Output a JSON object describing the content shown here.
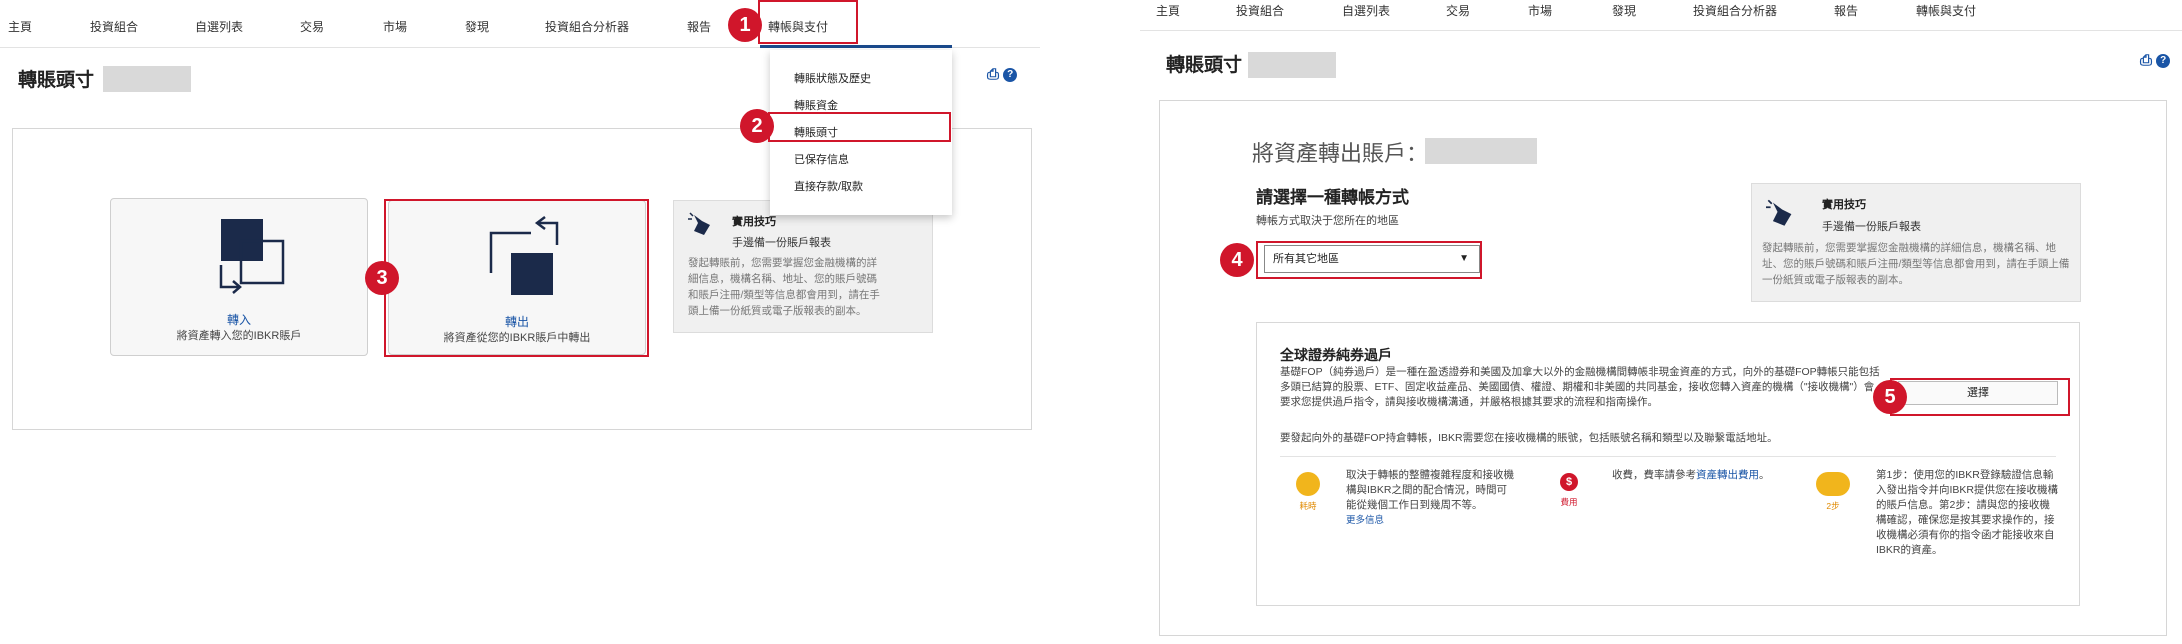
{
  "nav": {
    "items": [
      "主頁",
      "投資組合",
      "自選列表",
      "交易",
      "市場",
      "發現",
      "投資組合分析器",
      "報告",
      "轉帳與支付"
    ],
    "active": "轉帳與支付"
  },
  "left": {
    "page_title": "轉賬頭寸",
    "dropdown_items": [
      "轉賬狀態及歷史",
      "轉賬資金",
      "轉賬頭寸",
      "已保存信息",
      "直接存款/取款"
    ],
    "transfer_in": {
      "title": "轉入",
      "subtitle": "將資產轉入您的IBKR賬戶"
    },
    "transfer_out": {
      "title": "轉出",
      "subtitle": "將資產從您的IBKR賬戶中轉出"
    },
    "tip": {
      "title": "實用技巧",
      "subtitle": "手邊備一份賬戶報表",
      "body": "發起轉賬前，您需要掌握您金融機構的詳細信息，機構名稱、地址、您的賬戶號碼和賬戶注冊/類型等信息都會用到，請在手頭上備一份紙質或電子版報表的副本。"
    }
  },
  "right": {
    "page_title": "轉賬頭寸",
    "transfer_out_label": "將資產轉出賬戶：",
    "choose_method_title": "請選擇一種轉帳方式",
    "choose_method_sub": "轉帳方式取決于您所在的地區",
    "region_select": "所有其它地區",
    "tip": {
      "title": "實用技巧",
      "subtitle": "手邊備一份賬戶報表",
      "body": "發起轉賬前，您需要掌握您金融機構的詳細信息，機構名稱、地址、您的賬戶號碼和賬戶注冊/類型等信息都會用到，請在手頭上備一份紙質或電子版報表的副本。"
    },
    "fop": {
      "title": "全球證券純券過戶",
      "description": "基礎FOP（純券過戶）是一種在盈透證券和美國及加拿大以外的金融機構間轉帳非現金資產的方式，向外的基礎FOP轉帳只能包括多頭已結算的股票、ETF、固定收益產品、美國國債、權證、期權和非美國的共同基金，接收您轉入資產的機構（\"接收機構\"）會要求您提供過戶指令，請與接收機構溝通，并嚴格根據其要求的流程和指南操作。",
      "note": "要發起向外的基礎FOP持倉轉帳，IBKR需要您在接收機構的賬號，包括賬號名稱和類型以及聯繫電話地址。",
      "choose_button": "選擇",
      "info": [
        {
          "icon": "speedometer-icon",
          "caption": "耗時",
          "text": "取決于轉帳的整體複雜程度和接收機構與IBKR之間的配合情況，時間可能從幾個工作日到幾周不等。",
          "link": "更多信息"
        },
        {
          "icon": "dollar-icon",
          "caption": "費用",
          "text": "收費，費率請參考",
          "link": "資產轉出費用",
          "text_after": "。"
        },
        {
          "icon": "steps-icon",
          "caption": "2步",
          "text": "第1步：使用您的IBKR登錄驗證信息輸入發出指令并向IBKR提供您在接收機構的賬戶信息。第2步：請與您的接收機構確認，確保您是按其要求操作的，接收機構必須有你的指令函才能接收來自IBKR的資產。"
        }
      ]
    }
  },
  "badges": [
    "1",
    "2",
    "3",
    "4",
    "5"
  ],
  "colors": {
    "accent": "#1a4a8c",
    "highlight": "#d0162b",
    "link": "#1a55a6",
    "icon_dark": "#1b2a4a"
  }
}
